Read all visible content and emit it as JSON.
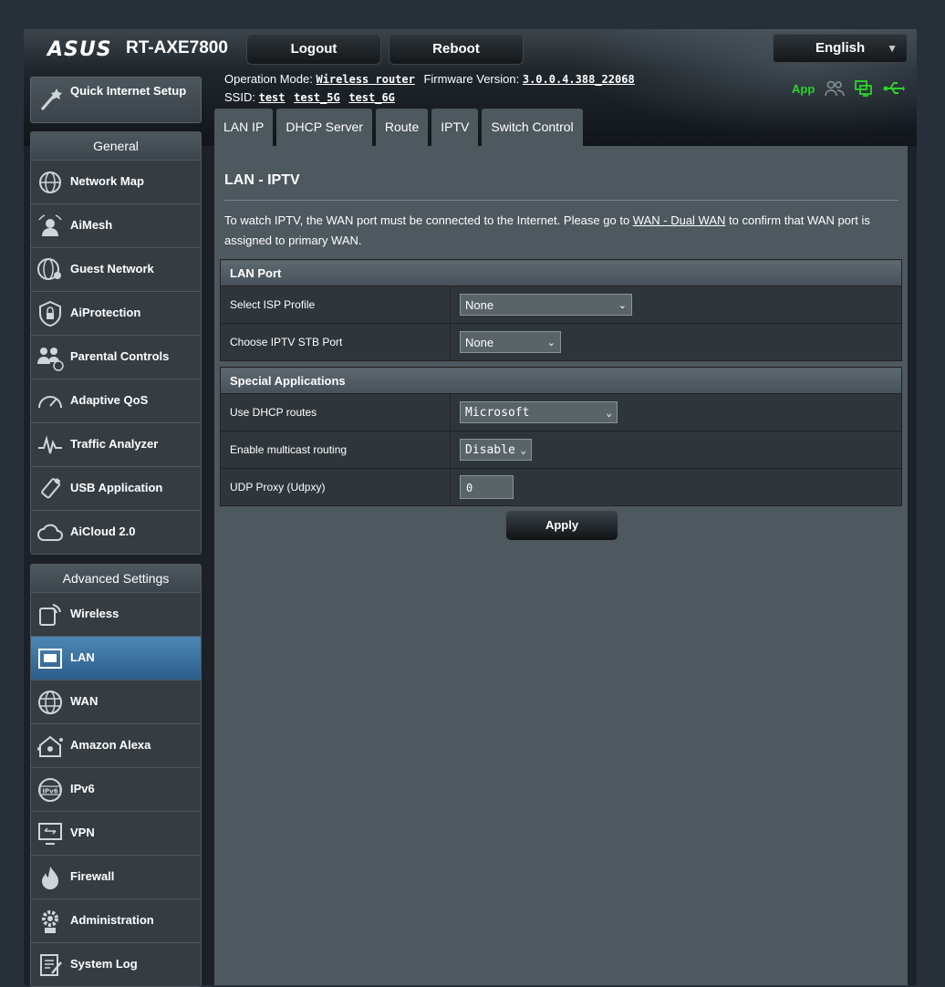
{
  "header": {
    "brand": "ASUS",
    "model": "RT-AXE7800",
    "logout_label": "Logout",
    "reboot_label": "Reboot",
    "language": "English",
    "operation_mode_label": "Operation Mode:",
    "operation_mode_value": "Wireless router",
    "firmware_label": "Firmware Version:",
    "firmware_value": "3.0.0.4.388_22068",
    "ssid_label": "SSID:",
    "ssids": [
      "test",
      "test_5G",
      "test_6G"
    ],
    "app_label": "App"
  },
  "sidebar": {
    "qis_label": "Quick Internet Setup",
    "general_title": "General",
    "general_items": [
      {
        "label": "Network Map"
      },
      {
        "label": "AiMesh"
      },
      {
        "label": "Guest Network"
      },
      {
        "label": "AiProtection"
      },
      {
        "label": "Parental Controls"
      },
      {
        "label": "Adaptive QoS"
      },
      {
        "label": "Traffic Analyzer"
      },
      {
        "label": "USB Application"
      },
      {
        "label": "AiCloud 2.0"
      }
    ],
    "advanced_title": "Advanced Settings",
    "advanced_items": [
      {
        "label": "Wireless"
      },
      {
        "label": "LAN"
      },
      {
        "label": "WAN"
      },
      {
        "label": "Amazon Alexa"
      },
      {
        "label": "IPv6"
      },
      {
        "label": "VPN"
      },
      {
        "label": "Firewall"
      },
      {
        "label": "Administration"
      },
      {
        "label": "System Log"
      }
    ]
  },
  "tabs": [
    {
      "label": "LAN IP"
    },
    {
      "label": "DHCP Server"
    },
    {
      "label": "Route"
    },
    {
      "label": "IPTV"
    },
    {
      "label": "Switch Control"
    }
  ],
  "main": {
    "title": "LAN - IPTV",
    "desc_before": "To watch IPTV, the WAN port must be connected to the Internet. Please go to ",
    "desc_link": "WAN - Dual WAN",
    "desc_after": " to confirm that WAN port is assigned to primary WAN.",
    "lan_port": {
      "title": "LAN Port",
      "isp_profile_label": "Select ISP Profile",
      "isp_profile_value": "None",
      "stb_port_label": "Choose IPTV STB Port",
      "stb_port_value": "None"
    },
    "special": {
      "title": "Special Applications",
      "dhcp_routes_label": "Use DHCP routes",
      "dhcp_routes_value": "Microsoft",
      "multicast_label": "Enable multicast routing",
      "multicast_value": "Disable",
      "udpxy_label": "UDP Proxy (Udpxy)",
      "udpxy_value": "0"
    },
    "apply_label": "Apply"
  }
}
